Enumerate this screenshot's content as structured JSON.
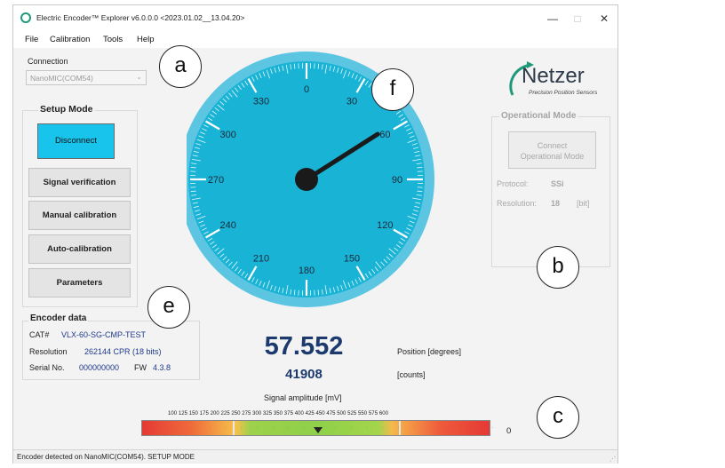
{
  "window": {
    "title": "Electric Encoder™ Explorer v6.0.0.0   <2023.01.02__13.04.20>",
    "minimize": "—",
    "maximize": "□",
    "close": "✕"
  },
  "menu": [
    "File",
    "Calibration",
    "Tools",
    "Help"
  ],
  "connection": {
    "label": "Connection",
    "value": "NanoMIC(COM54)"
  },
  "setup": {
    "title": "Setup Mode",
    "buttons": [
      "Disconnect",
      "Signal verification",
      "Manual calibration",
      "Auto-calibration",
      "Parameters"
    ]
  },
  "encoder": {
    "title": "Encoder data",
    "cat_label": "CAT#",
    "cat": "VLX-60-SG-CMP-TEST",
    "resolution_label": "Resolution",
    "resolution": "262144 CPR (18 bits)",
    "serial_label": "Serial No.",
    "serial": "000000000",
    "fw_label": "FW",
    "fw": "4.3.8"
  },
  "dial": {
    "labels": [
      "0",
      "30",
      "60",
      "90",
      "120",
      "150",
      "180",
      "210",
      "240",
      "270",
      "300",
      "330"
    ],
    "needle_degrees": 57.552
  },
  "reading": {
    "position": "57.552",
    "position_label": "Position [degrees]",
    "counts": "41908",
    "counts_label": "[counts]"
  },
  "signal": {
    "label": "Signal amplitude [mV]",
    "scale": [
      "100",
      "125",
      "150",
      "175",
      "200",
      "225",
      "250",
      "275",
      "300",
      "325",
      "350",
      "375",
      "400",
      "425",
      "450",
      "475",
      "500",
      "525",
      "550",
      "575",
      "600"
    ],
    "value_text": "0"
  },
  "logo": {
    "name": "Netzer",
    "tagline": "Precision Position Sensors"
  },
  "operational": {
    "title": "Operational Mode",
    "button_line1": "Connect",
    "button_line2": "Operational Mode",
    "protocol_label": "Protocol:",
    "protocol": "SSi",
    "resolution_label": "Resolution:",
    "resolution": "18",
    "resolution_unit": "[bit]"
  },
  "status": "Encoder detected on NanoMIC(COM54). SETUP MODE",
  "callouts": {
    "a": "a",
    "b": "b",
    "c": "c",
    "e": "e",
    "f": "f"
  },
  "colors": {
    "dial": "#19b3d6",
    "button_active": "#19c4ec",
    "value_blue": "#1c3a6e",
    "logo_teal": "#1e9a7a"
  }
}
